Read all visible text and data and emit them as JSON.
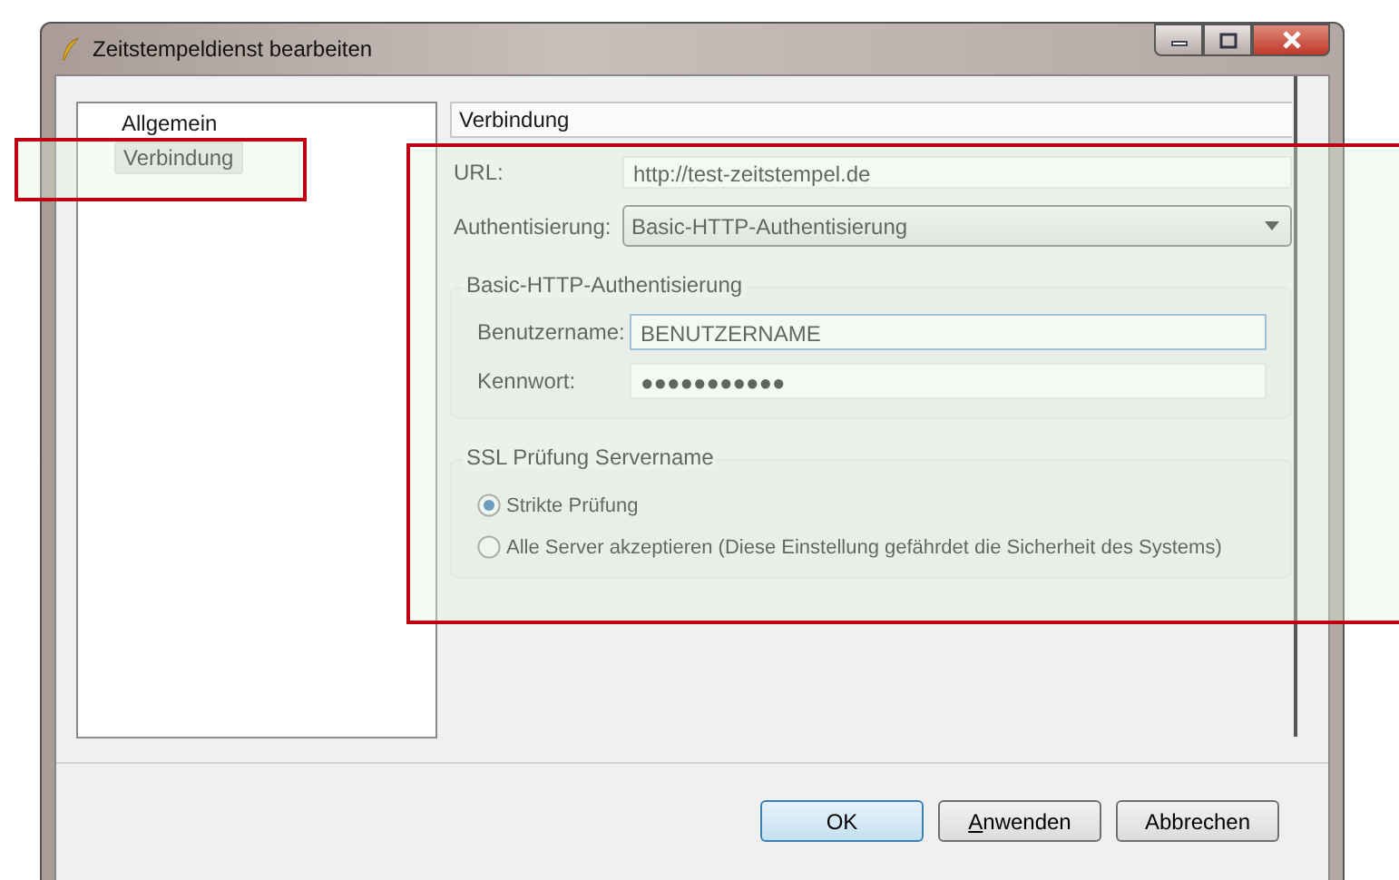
{
  "window": {
    "title": "Zeitstempeldienst bearbeiten"
  },
  "sidebar": {
    "items": [
      {
        "label": "Allgemein",
        "selected": false
      },
      {
        "label": "Verbindung",
        "selected": true
      }
    ]
  },
  "page_header": "Verbindung",
  "url": {
    "label": "URL:",
    "value": "http://test-zeitstempel.de"
  },
  "authentication": {
    "label": "Authentisierung:",
    "value": "Basic-HTTP-Authentisierung"
  },
  "basic_auth": {
    "title": "Basic-HTTP-Authentisierung",
    "fields": [
      {
        "label": "Benutzername:",
        "value": "BENUTZERNAME",
        "focused": true
      },
      {
        "label": "Kennwort:",
        "value": "●●●●●●●●●●●",
        "focused": false
      }
    ]
  },
  "ssl": {
    "title": "SSL Prüfung Servername",
    "options": [
      {
        "label": "Strikte Prüfung",
        "selected": true
      },
      {
        "label": "Alle Server akzeptieren (Diese Einstellung gefährdet die Sicherheit des Systems)",
        "selected": false
      }
    ]
  },
  "buttons": [
    {
      "label": "OK",
      "default": true,
      "underline_first": false
    },
    {
      "label": "Anwenden",
      "default": false,
      "underline_first": true
    },
    {
      "label": "Abbrechen",
      "default": false,
      "underline_first": false
    }
  ]
}
